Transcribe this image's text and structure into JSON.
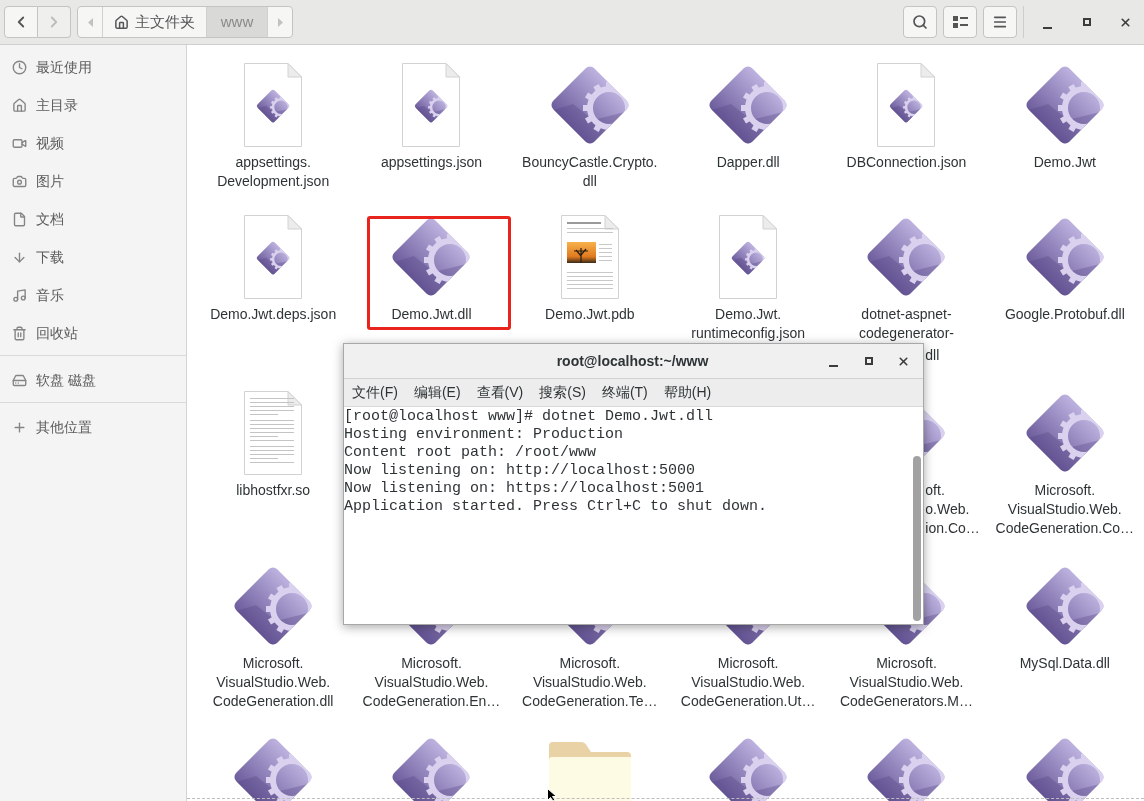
{
  "header": {
    "nav": [
      {
        "kind": "back",
        "disabled": false
      },
      {
        "kind": "forward",
        "disabled": true
      }
    ],
    "path": [
      {
        "label": "主文件夹",
        "kind": "home",
        "selected": false
      },
      {
        "label": "www",
        "kind": "plain",
        "selected": true
      }
    ]
  },
  "sidebar": {
    "sections": [
      {
        "items": [
          {
            "label": "最近使用",
            "kind": "recent"
          },
          {
            "label": "主目录",
            "kind": "home"
          },
          {
            "label": "视频",
            "kind": "video"
          },
          {
            "label": "图片",
            "kind": "pictures"
          },
          {
            "label": "文档",
            "kind": "documents"
          },
          {
            "label": "下载",
            "kind": "downloads"
          },
          {
            "label": "音乐",
            "kind": "music"
          },
          {
            "label": "回收站",
            "kind": "trash"
          }
        ]
      },
      {
        "items": [
          {
            "label": "软盘 磁盘",
            "kind": "drive"
          }
        ]
      },
      {
        "items": [
          {
            "label": "其他位置",
            "kind": "other"
          }
        ]
      }
    ]
  },
  "files": {
    "items": [
      {
        "kind": "json",
        "label": "appsettings.\nDevelopment.json",
        "highlighted": false
      },
      {
        "kind": "json",
        "label": "appsettings.json",
        "highlighted": false
      },
      {
        "kind": "diamond",
        "label": "BouncyCastle.Crypto.\ndll",
        "highlighted": false
      },
      {
        "kind": "diamond",
        "label": "Dapper.dll",
        "highlighted": false
      },
      {
        "kind": "json",
        "label": "DBConnection.json",
        "highlighted": false
      },
      {
        "kind": "diamond",
        "label": "Demo.Jwt",
        "highlighted": false
      },
      {
        "kind": "json",
        "label": "Demo.Jwt.deps.json",
        "highlighted": false
      },
      {
        "kind": "diamond",
        "label": "Demo.Jwt.dll",
        "highlighted": true
      },
      {
        "kind": "pdb",
        "label": "Demo.Jwt.pdb",
        "highlighted": false
      },
      {
        "kind": "json",
        "label": "Demo.Jwt.\nruntimeconfig.json",
        "highlighted": false
      },
      {
        "kind": "diamond",
        "label": "dotnet-aspnet-\ncodegenerator-",
        "label_tail": "dll",
        "highlighted": false
      },
      {
        "kind": "diamond",
        "label": "Google.Protobuf.dll",
        "highlighted": false
      },
      {
        "kind": "text",
        "label": "libhostfxr.so",
        "highlighted": false
      },
      {
        "kind": "diamond",
        "label_tail": "oft.\no.Web.\nion.Co…",
        "highlighted": false
      },
      {
        "kind": "diamond",
        "label": "Microsoft.\nVisualStudio.Web.\nCodeGeneration.Co…",
        "highlighted": false
      },
      {
        "kind": "diamond",
        "label": "Microsoft.\nVisualStudio.Web.\nCodeGeneration.dll",
        "highlighted": false
      },
      {
        "kind": "diamond",
        "label": "Microsoft.\nVisualStudio.Web.\nCodeGeneration.En…",
        "highlighted": false
      },
      {
        "kind": "diamond",
        "label": "Microsoft.\nVisualStudio.Web.\nCodeGeneration.Te…",
        "highlighted": false
      },
      {
        "kind": "diamond",
        "label": "Microsoft.\nVisualStudio.Web.\nCodeGeneration.Ut…",
        "highlighted": false
      },
      {
        "kind": "diamond",
        "label": "Microsoft.\nVisualStudio.Web.\nCodeGenerators.M…",
        "highlighted": false
      },
      {
        "kind": "diamond",
        "label": "MySql.Data.dll",
        "highlighted": false
      },
      {
        "kind": "diamond",
        "highlighted": false
      },
      {
        "kind": "diamond",
        "highlighted": false
      },
      {
        "kind": "folder",
        "highlighted": false
      },
      {
        "kind": "diamond",
        "highlighted": false
      },
      {
        "kind": "diamond",
        "highlighted": false
      },
      {
        "kind": "diamond",
        "highlighted": false
      }
    ]
  },
  "terminal": {
    "title": "root@localhost:~/www",
    "menu": [
      "文件(F)",
      "编辑(E)",
      "查看(V)",
      "搜索(S)",
      "终端(T)",
      "帮助(H)"
    ],
    "lines": [
      "[root@localhost www]# dotnet Demo.Jwt.dll",
      "Hosting environment: Production",
      "Content root path: /root/www",
      "Now listening on: http://localhost:5000",
      "Now listening on: https://localhost:5001",
      "Application started. Press Ctrl+C to shut down."
    ]
  }
}
